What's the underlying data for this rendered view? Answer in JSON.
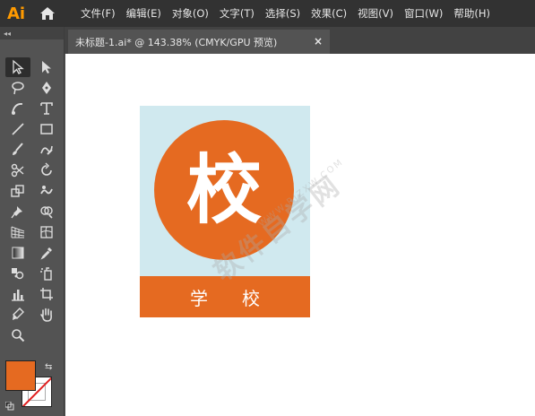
{
  "app": {
    "logo": "Ai"
  },
  "menu": [
    "文件(F)",
    "编辑(E)",
    "对象(O)",
    "文字(T)",
    "选择(S)",
    "效果(C)",
    "视图(V)",
    "窗口(W)",
    "帮助(H)"
  ],
  "toolbar": {
    "grip": "◂◂"
  },
  "document": {
    "tab_title": "未标题-1.ai* @ 143.38% (CMYK/GPU 预览)",
    "close": "×"
  },
  "artwork": {
    "circle_char": "校",
    "banner_chars": [
      "学",
      "校"
    ],
    "colors": {
      "orange": "#E56A21",
      "light_blue": "#D0E9EF"
    }
  },
  "watermark": {
    "main": "软件自学网",
    "sub": "WWW.RJZXW.COM"
  },
  "swatch": {
    "fill_color": "#E56A21",
    "swap": "⇆"
  }
}
